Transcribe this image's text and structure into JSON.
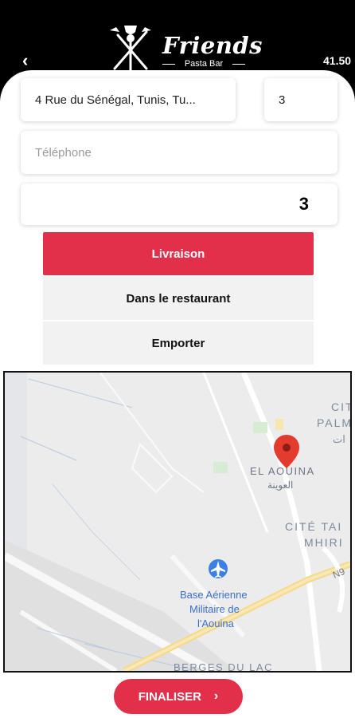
{
  "header": {
    "back_icon": "chevron-left-icon",
    "logo_title": "Friends",
    "logo_subtitle": "Pasta Bar",
    "price": "41.50"
  },
  "form": {
    "address_value": "4 Rue du Sénégal, Tunis, Tu...",
    "number_value": "3",
    "phone_placeholder": "Téléphone",
    "quantity_value": "3"
  },
  "options": {
    "livraison": "Livraison",
    "restaurant": "Dans le restaurant",
    "emporter": "Emporter",
    "selected": "livraison",
    "accent": "#e3304a"
  },
  "map": {
    "labels": {
      "cite_palm_1": "CIT",
      "cite_palm_2": "PALM",
      "cite_palm_ar": "ات",
      "el_aouina": "EL AOUINA",
      "el_aouina_ar": "العوينة",
      "cite_tai": "CITÉ TAI",
      "mhiri": "MHIRI",
      "road": "N9",
      "base_1": "Base Aérienne",
      "base_2": "Militaire de",
      "base_3": "l'Aouina",
      "berges": "BERGES DU LAC"
    },
    "pin_icon": "map-pin-icon",
    "airport_icon": "airport-icon"
  },
  "footer": {
    "finalize_label": "FINALISER",
    "finalize_icon": "chevron-right-icon"
  }
}
